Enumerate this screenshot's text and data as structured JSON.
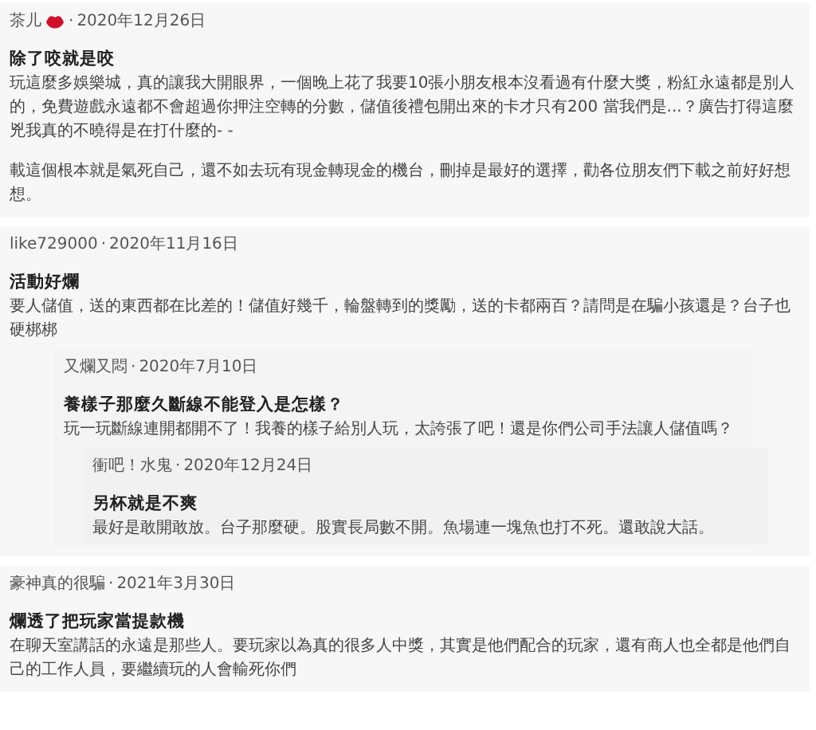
{
  "reviews": [
    {
      "author": "茶儿",
      "lips_icon": true,
      "separator": "·",
      "date": "2020年12月26日",
      "title": "除了咬就是咬",
      "paragraphs": [
        "玩這麼多娛樂城，真的讓我大開眼界，一個晚上花了我要10張小朋友根本沒看過有什麼大獎，粉紅永遠都是別人的，免費遊戲永遠都不會超過你押注空轉的分數，儲值後禮包開出來的卡才只有200 當我們是...？廣告打得這麼兇我真的不曉得是在打什麼的- -",
        "載這個根本就是氣死自己，還不如去玩有現金轉現金的機台，刪掉是最好的選擇，勸各位朋友們下載之前好好想想。"
      ]
    },
    {
      "author": "like729000",
      "separator": "·",
      "date": "2020年11月16日",
      "title": "活動好爛",
      "paragraphs": [
        "要人儲值，送的東西都在比差的！儲值好幾千，輪盤轉到的獎勵，送的卡都兩百？請問是在騙小孩還是？台子也硬梆梆"
      ],
      "replies": [
        {
          "author": "又爛又悶",
          "separator": "·",
          "date": "2020年7月10日",
          "title": "養樣子那麼久斷線不能登入是怎樣？",
          "paragraphs": [
            "玩一玩斷線連開都開不了！我養的樣子給別人玩，太誇張了吧！還是你們公司手法讓人儲值嗎？"
          ],
          "replies": [
            {
              "author": "衝吧！水鬼",
              "separator": "·",
              "date": "2020年12月24日",
              "title": "另杯就是不爽",
              "paragraphs": [
                "最好是敢開敢放。台子那麼硬。股實長局數不開。魚場連一塊魚也打不死。還敢說大話。"
              ]
            }
          ]
        }
      ]
    },
    {
      "author": "豪神真的很騙",
      "separator": "·",
      "date": "2021年3月30日",
      "title": "爛透了把玩家當提款機",
      "paragraphs": [
        "在聊天室講話的永遠是那些人。要玩家以為真的很多人中獎，其實是他們配合的玩家，還有商人也全都是他們自己的工作人員，要繼續玩的人會輸死你們"
      ]
    }
  ]
}
